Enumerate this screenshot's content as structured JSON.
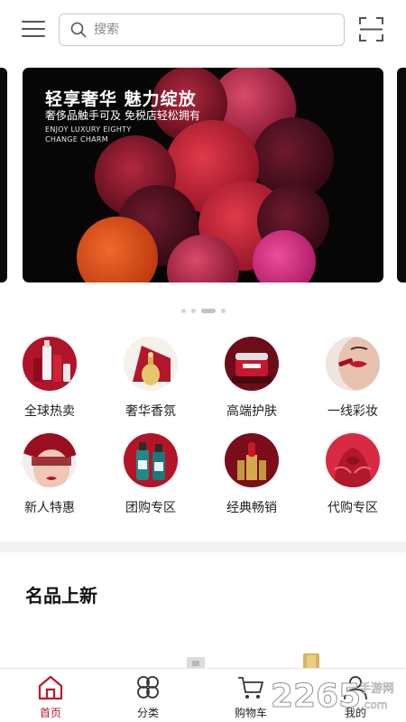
{
  "search": {
    "placeholder": "搜索"
  },
  "banner": {
    "headline": "轻享奢华 魅力绽放",
    "subline": "奢侈品触手可及 免税店轻松拥有",
    "english_line1": "ENJOY LUXURY EIGHTY",
    "english_line2": "CHANGE CHARM",
    "page_count": 4,
    "active_page": 3
  },
  "categories": [
    {
      "label": "全球热卖",
      "icon": "skincare-bottles-icon"
    },
    {
      "label": "奢华香氛",
      "icon": "perfume-icon"
    },
    {
      "label": "高端护肤",
      "icon": "cream-jar-icon"
    },
    {
      "label": "一线彩妆",
      "icon": "lipstick-model-icon"
    },
    {
      "label": "新人特惠",
      "icon": "lace-mask-model-icon"
    },
    {
      "label": "团购专区",
      "icon": "shampoo-bottles-icon"
    },
    {
      "label": "经典畅销",
      "icon": "ysl-lipstick-icon"
    },
    {
      "label": "代购专区",
      "icon": "red-dress-icon"
    }
  ],
  "section": {
    "title": "名品上新"
  },
  "tabbar": [
    {
      "label": "首页",
      "icon": "home-icon",
      "active": true
    },
    {
      "label": "分类",
      "icon": "category-icon",
      "active": false
    },
    {
      "label": "购物车",
      "icon": "cart-icon",
      "active": false
    },
    {
      "label": "我的",
      "icon": "user-icon",
      "active": false
    }
  ],
  "watermark": {
    "text": "2265",
    "suffix": "手游网",
    "domain": ".com"
  },
  "colors": {
    "accent": "#c0172c",
    "banner_bg": "#060606",
    "divider": "#f2f2f2"
  }
}
